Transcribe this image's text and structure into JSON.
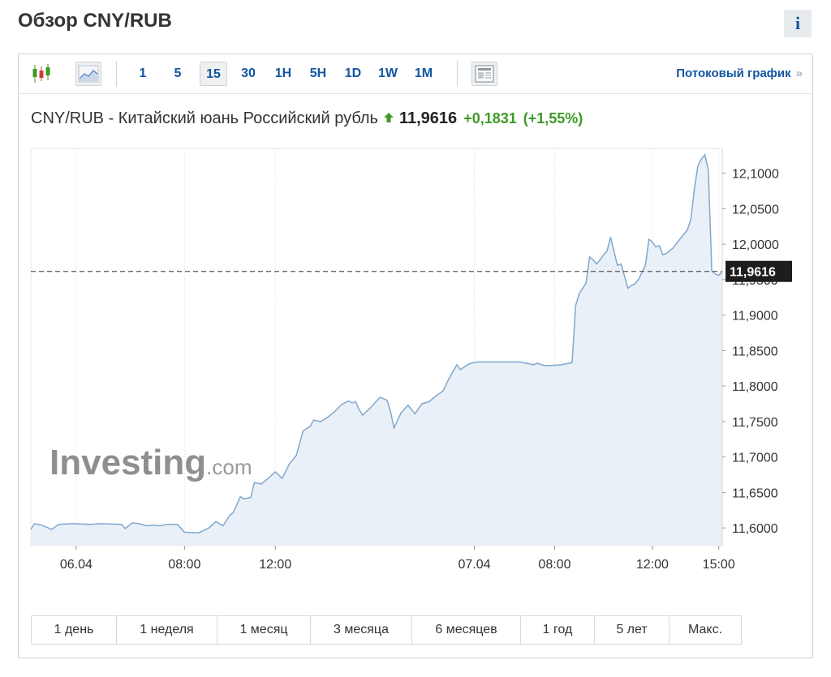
{
  "page": {
    "title": "Обзор CNY/RUB",
    "info_label": "i"
  },
  "toolbar": {
    "intervals": [
      "1",
      "5",
      "15",
      "30",
      "1H",
      "5H",
      "1D",
      "1W",
      "1M"
    ],
    "active_interval": "15",
    "stream_label": "Потоковый график",
    "stream_arrow": "»"
  },
  "headline": {
    "name": "CNY/RUB - Китайский юань Российский рубль",
    "price": "11,9616",
    "change": "+0,1831",
    "change_pct": "(+1,55%)"
  },
  "colors": {
    "accent": "#1256a0",
    "up": "#3d9a27",
    "line": "#7fa8cf",
    "area": "#e9eff7"
  },
  "watermark": {
    "main": "Investing",
    "suffix": ".com"
  },
  "chart_data": {
    "type": "area",
    "current_label": "11,9616",
    "current_value": 11.9616,
    "ylim": [
      11.575,
      12.135
    ],
    "yticks": [
      {
        "v": 11.6,
        "label": "11,6000"
      },
      {
        "v": 11.65,
        "label": "11,6500"
      },
      {
        "v": 11.7,
        "label": "11,7000"
      },
      {
        "v": 11.75,
        "label": "11,7500"
      },
      {
        "v": 11.8,
        "label": "11,8000"
      },
      {
        "v": 11.85,
        "label": "11,8500"
      },
      {
        "v": 11.9,
        "label": "11,9000"
      },
      {
        "v": 11.95,
        "label": "11,9500"
      },
      {
        "v": 12.0,
        "label": "12,0000"
      },
      {
        "v": 12.05,
        "label": "12,0500"
      },
      {
        "v": 12.1,
        "label": "12,1000"
      }
    ],
    "xticks": [
      {
        "i": 13,
        "label": "06.04"
      },
      {
        "i": 44,
        "label": "08:00"
      },
      {
        "i": 70,
        "label": "12:00"
      },
      {
        "i": 127,
        "label": "07.04"
      },
      {
        "i": 150,
        "label": "08:00"
      },
      {
        "i": 178,
        "label": "12:00"
      },
      {
        "i": 197,
        "label": "15:00"
      }
    ],
    "x_count": 199,
    "series": [
      {
        "values": [
          [
            0,
            11.598
          ],
          [
            1,
            11.606
          ],
          [
            3,
            11.604
          ],
          [
            6,
            11.598
          ],
          [
            8,
            11.605
          ],
          [
            12,
            11.606
          ],
          [
            17,
            11.605
          ],
          [
            20,
            11.606
          ],
          [
            26,
            11.605
          ],
          [
            27,
            11.599
          ],
          [
            29,
            11.607
          ],
          [
            31,
            11.606
          ],
          [
            33,
            11.603
          ],
          [
            35,
            11.604
          ],
          [
            37,
            11.603
          ],
          [
            39,
            11.605
          ],
          [
            42,
            11.605
          ],
          [
            44,
            11.594
          ],
          [
            48,
            11.593
          ],
          [
            51,
            11.6
          ],
          [
            53,
            11.609
          ],
          [
            55,
            11.603
          ],
          [
            57,
            11.618
          ],
          [
            58,
            11.622
          ],
          [
            60,
            11.644
          ],
          [
            61,
            11.641
          ],
          [
            63,
            11.643
          ],
          [
            64,
            11.664
          ],
          [
            66,
            11.662
          ],
          [
            68,
            11.67
          ],
          [
            70,
            11.679
          ],
          [
            72,
            11.67
          ],
          [
            74,
            11.69
          ],
          [
            76,
            11.702
          ],
          [
            78,
            11.737
          ],
          [
            80,
            11.743
          ],
          [
            81,
            11.752
          ],
          [
            83,
            11.75
          ],
          [
            85,
            11.756
          ],
          [
            87,
            11.764
          ],
          [
            89,
            11.774
          ],
          [
            91,
            11.779
          ],
          [
            92,
            11.776
          ],
          [
            93,
            11.778
          ],
          [
            94,
            11.767
          ],
          [
            95,
            11.759
          ],
          [
            97,
            11.768
          ],
          [
            99,
            11.779
          ],
          [
            100,
            11.784
          ],
          [
            102,
            11.78
          ],
          [
            103,
            11.764
          ],
          [
            104,
            11.741
          ],
          [
            106,
            11.762
          ],
          [
            108,
            11.773
          ],
          [
            109,
            11.767
          ],
          [
            110,
            11.761
          ],
          [
            112,
            11.775
          ],
          [
            114,
            11.778
          ],
          [
            116,
            11.786
          ],
          [
            118,
            11.793
          ],
          [
            120,
            11.813
          ],
          [
            122,
            11.83
          ],
          [
            123,
            11.823
          ],
          [
            125,
            11.83
          ],
          [
            126,
            11.832
          ],
          [
            128,
            11.834
          ],
          [
            131,
            11.834
          ],
          [
            135,
            11.834
          ],
          [
            140,
            11.834
          ],
          [
            142,
            11.832
          ],
          [
            144,
            11.83
          ],
          [
            145,
            11.832
          ],
          [
            147,
            11.829
          ],
          [
            149,
            11.829
          ],
          [
            152,
            11.83
          ],
          [
            155,
            11.833
          ],
          [
            156,
            11.913
          ],
          [
            157,
            11.93
          ],
          [
            159,
            11.945
          ],
          [
            160,
            11.982
          ],
          [
            161,
            11.978
          ],
          [
            162,
            11.972
          ],
          [
            163,
            11.978
          ],
          [
            164,
            11.985
          ],
          [
            165,
            11.99
          ],
          [
            166,
            12.01
          ],
          [
            167,
            11.99
          ],
          [
            168,
            11.97
          ],
          [
            169,
            11.972
          ],
          [
            170,
            11.955
          ],
          [
            171,
            11.938
          ],
          [
            172,
            11.942
          ],
          [
            173,
            11.944
          ],
          [
            174,
            11.95
          ],
          [
            175,
            11.96
          ],
          [
            176,
            11.97
          ],
          [
            177,
            12.007
          ],
          [
            178,
            12.003
          ],
          [
            179,
            11.996
          ],
          [
            180,
            11.998
          ],
          [
            181,
            11.985
          ],
          [
            182,
            11.987
          ],
          [
            184,
            11.995
          ],
          [
            186,
            12.008
          ],
          [
            188,
            12.02
          ],
          [
            189,
            12.035
          ],
          [
            190,
            12.077
          ],
          [
            191,
            12.11
          ],
          [
            192,
            12.12
          ],
          [
            193,
            12.126
          ],
          [
            194,
            12.105
          ],
          [
            195,
            11.962
          ],
          [
            196,
            11.958
          ],
          [
            197,
            11.956
          ],
          [
            198,
            11.9616
          ]
        ]
      }
    ]
  },
  "ranges": [
    "1 день",
    "1 неделя",
    "1 месяц",
    "3 месяца",
    "6 месяцев",
    "1 год",
    "5 лет",
    "Макс."
  ]
}
